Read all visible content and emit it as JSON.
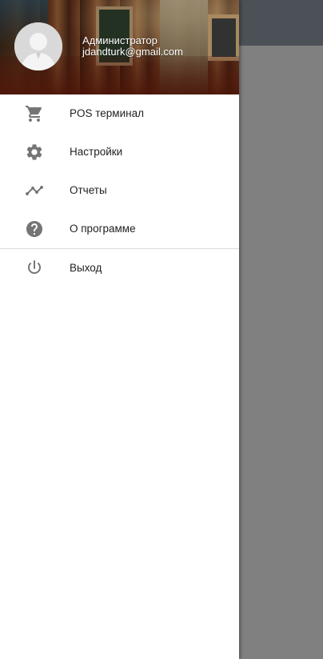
{
  "drawer": {
    "user": {
      "name": "Администратор",
      "email": "jdandturk@gmail.com"
    },
    "items": [
      {
        "label": "POS терминал",
        "icon": "shopping-cart-icon"
      },
      {
        "label": "Настройки",
        "icon": "gear-icon"
      },
      {
        "label": "Отчеты",
        "icon": "trending-line-icon"
      },
      {
        "label": "О программе",
        "icon": "help-circle-icon"
      }
    ],
    "footer_items": [
      {
        "label": "Выход",
        "icon": "power-icon"
      }
    ]
  },
  "colors": {
    "icon": "#757575",
    "text": "#222222",
    "scrim": "#7f7f7f",
    "toolbar": "#4c5157"
  }
}
